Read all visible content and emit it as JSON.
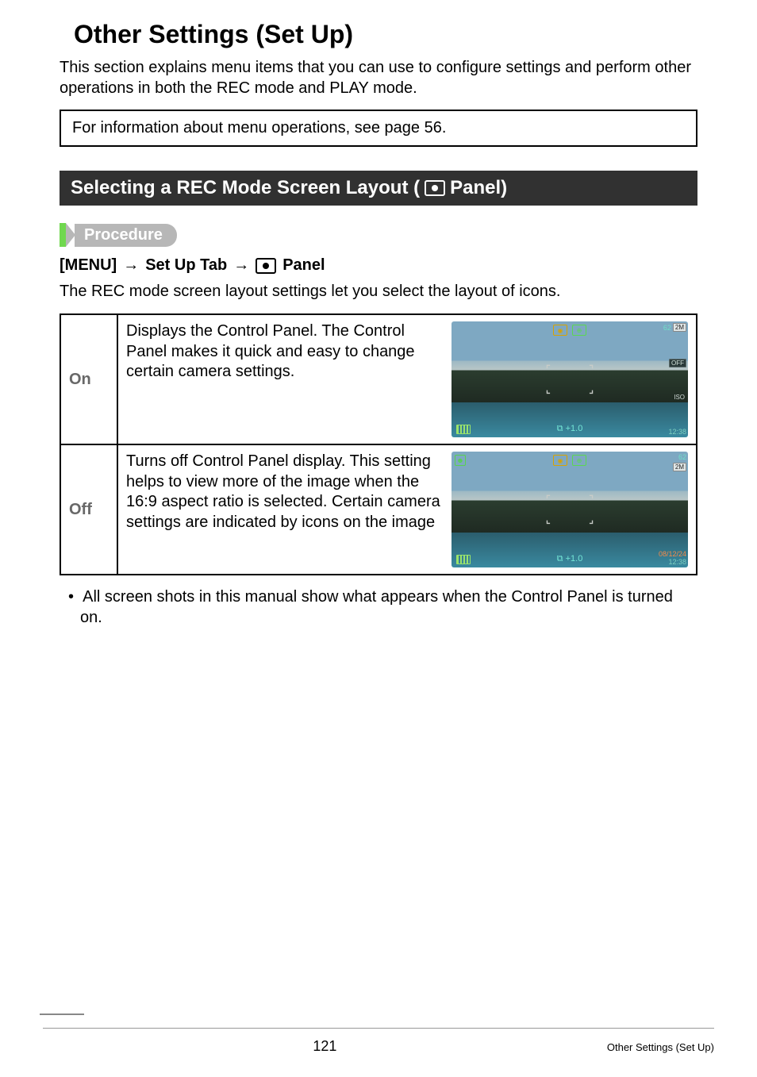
{
  "title": "Other Settings (Set Up)",
  "intro": "This section explains menu items that you can use to configure settings and perform other operations in both the REC mode and PLAY mode.",
  "info_box": "For information about menu operations, see page 56.",
  "section_bar": {
    "prefix": "Selecting a REC Mode Screen Layout (",
    "suffix": " Panel)"
  },
  "procedure_label": "Procedure",
  "procedure_steps": {
    "menu": "[MENU]",
    "setup": "Set Up Tab",
    "panel": "Panel"
  },
  "layout_desc": "The REC mode screen layout settings let you select the layout of icons.",
  "table": {
    "rows": [
      {
        "label": "On",
        "text": "Displays the Control Panel. The Control Panel makes it quick and easy to change certain camera settings.",
        "screenshot": {
          "type": "on",
          "count": "62",
          "size_badge": "2M",
          "iso": "ISO",
          "time": "12:38",
          "ev": "+1.0",
          "off_badge": "OFF"
        }
      },
      {
        "label": "Off",
        "text": "Turns off Control Panel display. This setting helps to view more of the image when the 16:9 aspect ratio is selected. Certain camera settings are indicated by icons on the image",
        "screenshot": {
          "type": "off",
          "count": "62",
          "size_badge": "2M",
          "date": "08/12/24",
          "time": "12:38",
          "ev": "+1.0"
        }
      }
    ]
  },
  "bullet": "All screen shots in this manual show what appears when the Control Panel is turned on.",
  "footer": {
    "page": "121",
    "section": "Other Settings (Set Up)"
  }
}
